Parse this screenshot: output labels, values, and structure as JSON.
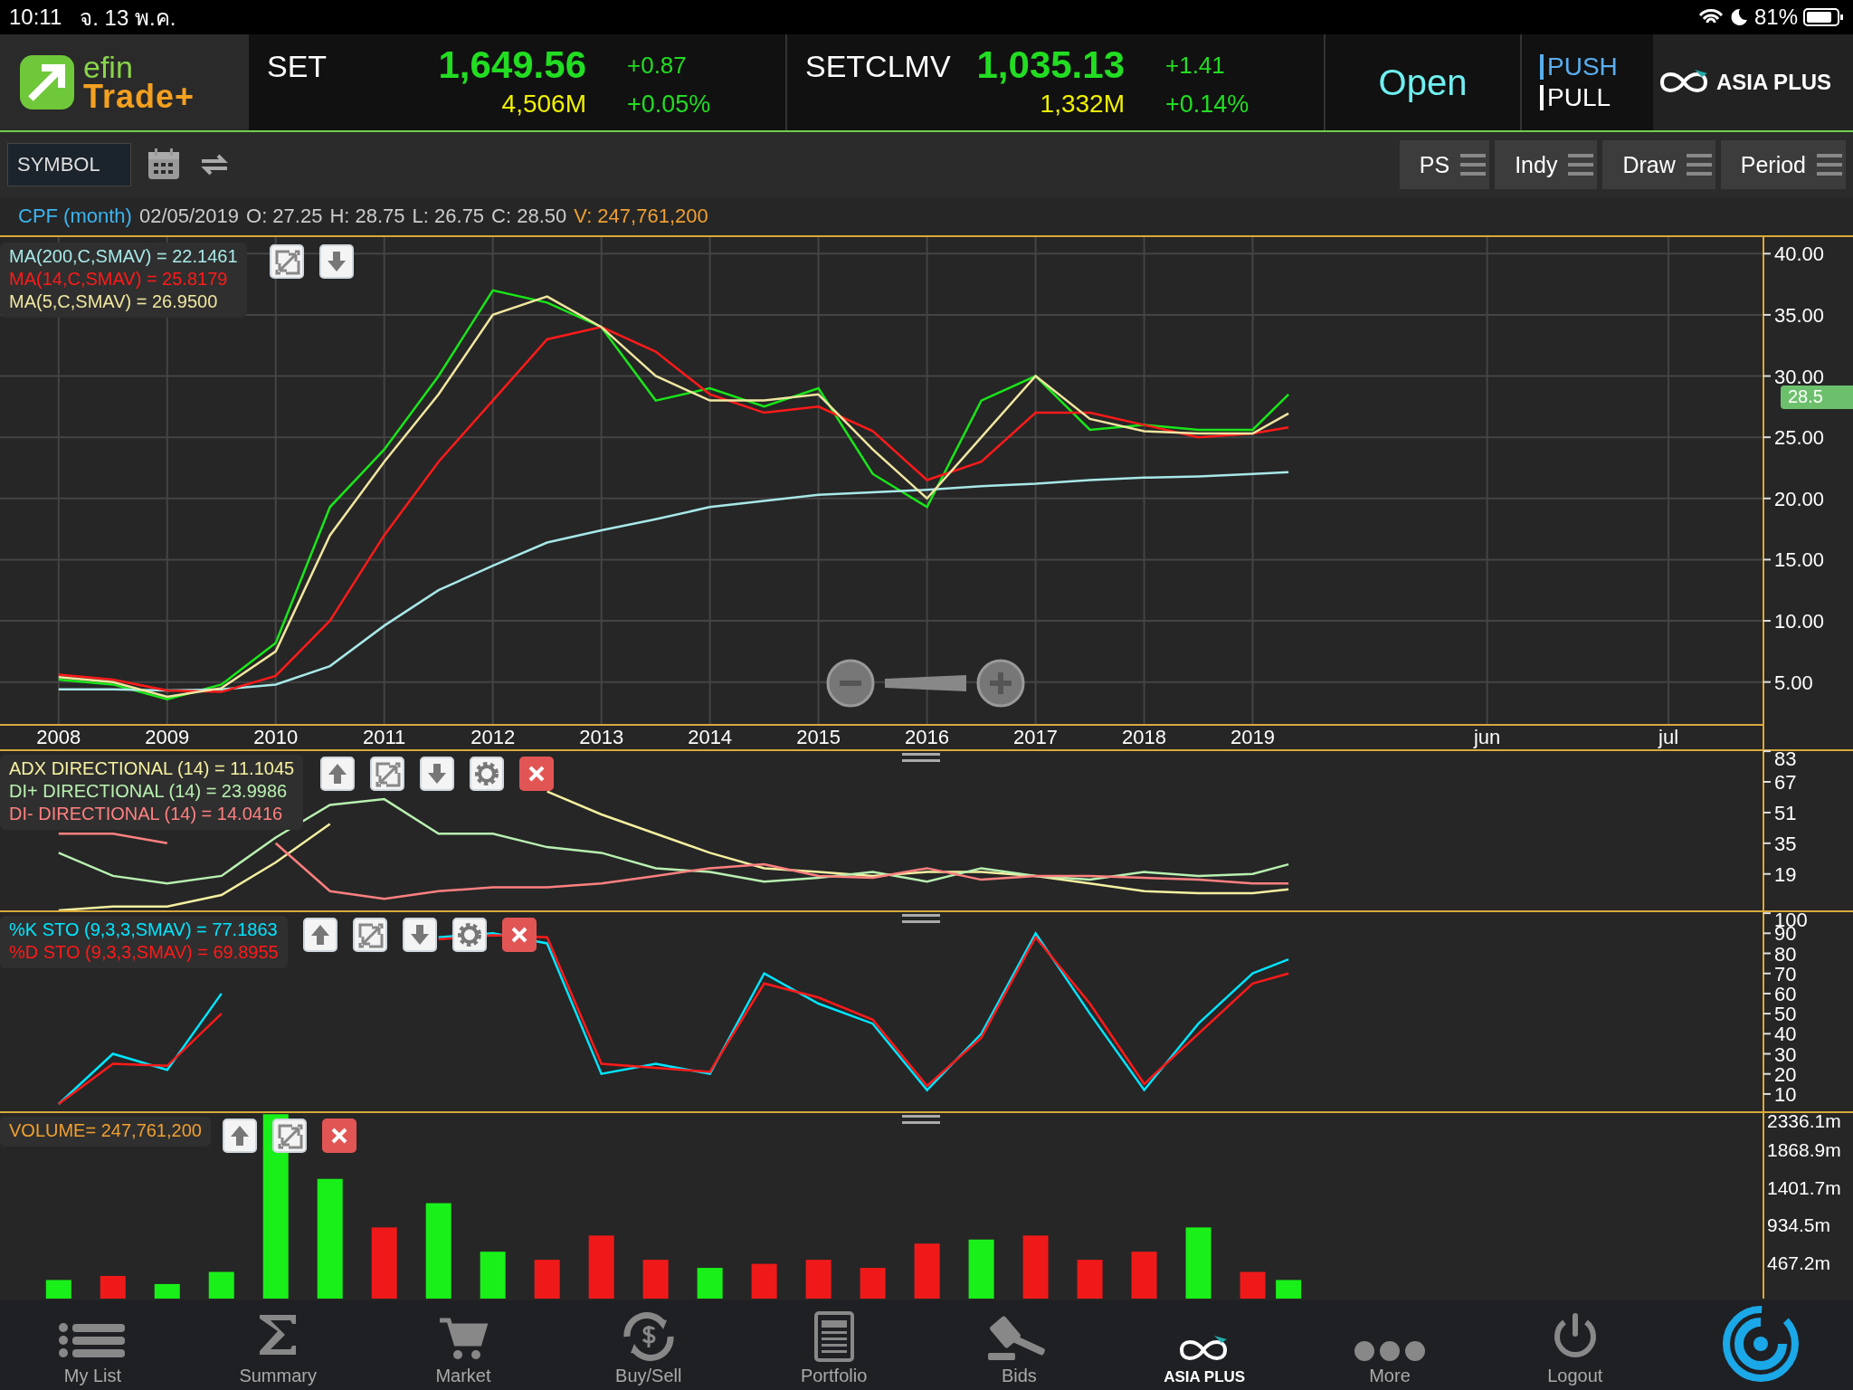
{
  "status_bar": {
    "time": "10:11",
    "date": "จ. 13 พ.ค.",
    "battery": "81%"
  },
  "header": {
    "logo": {
      "line1": "efin",
      "line2": "Trade+"
    },
    "indices": [
      {
        "name": "SET",
        "value": "1,649.56",
        "change": "+0.87",
        "volume": "4,506M",
        "percent": "+0.05%"
      },
      {
        "name": "SETCLMV",
        "value": "1,035.13",
        "change": "+1.41",
        "volume": "1,332M",
        "percent": "+0.14%"
      }
    ],
    "market_status": "Open",
    "modes": [
      {
        "label": "PUSH",
        "selected": true
      },
      {
        "label": "PULL",
        "selected": false
      }
    ],
    "broker_logo": "ASIA PLUS"
  },
  "toolbar": {
    "symbol": {
      "placeholder": "SYMBOL"
    },
    "menus": [
      "PS",
      "Indy",
      "Draw",
      "Period"
    ]
  },
  "info_line": [
    {
      "kind": "symbol",
      "text": "CPF (month)"
    },
    {
      "kind": "plain",
      "text": "02/05/2019"
    },
    {
      "kind": "plain",
      "text": "O:  27.25"
    },
    {
      "kind": "plain",
      "text": "H:  28.75"
    },
    {
      "kind": "plain",
      "text": "L:  26.75"
    },
    {
      "kind": "plain",
      "text": "C:  28.50"
    },
    {
      "kind": "volume",
      "text": "V:  247,761,200"
    }
  ],
  "panels": [
    {
      "kind": "price",
      "legend": [
        {
          "text": "MA(200,C,SMAV) = 22.1461",
          "color": "#a8e8e8"
        },
        {
          "text": "MA(14,C,SMAV) = 25.8179",
          "color": "#ff1a1a"
        },
        {
          "text": "MA(5,C,SMAV) = 26.9500",
          "color": "#f0e6a0"
        }
      ],
      "tools": [
        {
          "kind": "maximize"
        },
        {
          "kind": "down"
        }
      ],
      "last_price_tag": "28.5",
      "chart_data": {
        "type": "line",
        "grid": true,
        "x": [
          2008,
          2008.5,
          2009,
          2009.5,
          2010,
          2010.5,
          2011,
          2011.5,
          2012,
          2012.5,
          2013,
          2013.5,
          2014,
          2014.5,
          2015,
          2015.5,
          2016,
          2016.5,
          2017,
          2017.5,
          2018,
          2018.5,
          2019,
          2019.33
        ],
        "xlim": [
          2007.46,
          2024.53
        ],
        "ylim": [
          1.5,
          41.5
        ],
        "xticks": [
          {
            "value": 2008,
            "label": "2008"
          },
          {
            "value": 2009,
            "label": "2009"
          },
          {
            "value": 2010,
            "label": "2010"
          },
          {
            "value": 2011,
            "label": "2011"
          },
          {
            "value": 2012,
            "label": "2012"
          },
          {
            "value": 2013,
            "label": "2013"
          },
          {
            "value": 2014,
            "label": "2014"
          },
          {
            "value": 2015,
            "label": "2015"
          },
          {
            "value": 2016,
            "label": "2016"
          },
          {
            "value": 2017,
            "label": "2017"
          },
          {
            "value": 2018,
            "label": "2018"
          },
          {
            "value": 2019,
            "label": "2019"
          },
          {
            "value": 2021.16,
            "label": "jun"
          },
          {
            "value": 2022.83,
            "label": "jul"
          }
        ],
        "yticks": [
          {
            "value": 40,
            "label": "40.00"
          },
          {
            "value": 35,
            "label": "35.00"
          },
          {
            "value": 30,
            "label": "30.00"
          },
          {
            "value": 25,
            "label": "25.00"
          },
          {
            "value": 20,
            "label": "20.00"
          },
          {
            "value": 15,
            "label": "15.00"
          },
          {
            "value": 10,
            "label": "10.00"
          },
          {
            "value": 5,
            "label": "5.00"
          }
        ],
        "series": [
          {
            "color": "#19e619",
            "values": [
              5.2,
              4.8,
              3.6,
              4.8,
              8.2,
              19.3,
              24,
              30,
              37,
              36,
              34,
              28,
              29,
              27.5,
              29,
              22,
              19.3,
              28,
              30,
              25.6,
              26,
              25.6,
              25.6,
              28.5
            ]
          },
          {
            "color": "#a8e8e8",
            "values": [
              4.4,
              4.4,
              4.3,
              4.4,
              4.8,
              6.3,
              9.6,
              12.5,
              14.5,
              16.4,
              17.4,
              18.3,
              19.3,
              19.8,
              20.3,
              20.5,
              20.7,
              21,
              21.2,
              21.5,
              21.7,
              21.8,
              22,
              22.15
            ]
          },
          {
            "color": "#ff1a1a",
            "values": [
              5.6,
              5.2,
              4.3,
              4.2,
              5.5,
              10,
              17,
              23,
              28,
              33,
              34,
              32,
              28.5,
              27,
              27.5,
              25.5,
              21.5,
              23,
              27,
              27,
              26,
              25,
              25.3,
              25.8
            ]
          },
          {
            "color": "#f0e6a0",
            "values": [
              5.4,
              5,
              3.8,
              4.5,
              7.5,
              17,
              23,
              28.5,
              35,
              36.5,
              34,
              30,
              28,
              28,
              28.5,
              24,
              20,
              25,
              30,
              26.5,
              25.5,
              25.3,
              25.3,
              26.95
            ]
          }
        ]
      }
    },
    {
      "kind": "adx",
      "legend": [
        {
          "text": "ADX DIRECTIONAL (14) = 11.1045",
          "color": "#f5f0a0"
        },
        {
          "text": "DI+ DIRECTIONAL (14) = 23.9986",
          "color": "#b8f0b0"
        },
        {
          "text": "DI- DIRECTIONAL (14) = 14.0416",
          "color": "#ff8080"
        }
      ],
      "tools": [
        {
          "kind": "up"
        },
        {
          "kind": "maximize"
        },
        {
          "kind": "down"
        },
        {
          "kind": "settings"
        },
        {
          "kind": "close"
        }
      ],
      "chart_data": {
        "type": "line",
        "x": [
          2008,
          2008.5,
          2009,
          2009.5,
          2010,
          2010.5,
          2011,
          2011.5,
          2012,
          2012.5,
          2013,
          2013.5,
          2014,
          2014.5,
          2015,
          2015.5,
          2016,
          2016.5,
          2017,
          2017.5,
          2018,
          2018.5,
          2019,
          2019.33
        ],
        "xlim": [
          2007.46,
          2024.53
        ],
        "ylim": [
          0,
          84
        ],
        "yticks": [
          83,
          67,
          51,
          35,
          19
        ],
        "series": [
          {
            "color": "#f5f0a0",
            "values": [
              0,
              2,
              2,
              8,
              25,
              45,
              null,
              null,
              null,
              62,
              50,
              40,
              30,
              22,
              20,
              18,
              20,
              20,
              18,
              14,
              10,
              9,
              9,
              11
            ]
          },
          {
            "color": "#b8f0b0",
            "values": [
              30,
              18,
              14,
              18,
              38,
              55,
              58,
              40,
              40,
              33,
              30,
              22,
              20,
              15,
              17,
              20,
              15,
              22,
              18,
              16,
              20,
              18,
              19,
              24
            ]
          },
          {
            "color": "#ff8080",
            "values": [
              40,
              40,
              35,
              null,
              35,
              10,
              6,
              10,
              12,
              12,
              14,
              18,
              22,
              24,
              18,
              17,
              22,
              16,
              18,
              18,
              17,
              16,
              14,
              14
            ]
          }
        ]
      }
    },
    {
      "kind": "stochastic",
      "legend": [
        {
          "text": "%K STO (9,3,3,SMAV) = 77.1863",
          "color": "#00e5ff"
        },
        {
          "text": "%D STO (9,3,3,SMAV) = 69.8955",
          "color": "#ff1a1a"
        }
      ],
      "tools": [
        {
          "kind": "up"
        },
        {
          "kind": "maximize"
        },
        {
          "kind": "down"
        },
        {
          "kind": "settings"
        },
        {
          "kind": "close"
        }
      ],
      "chart_data": {
        "type": "line",
        "x": [
          2008,
          2008.5,
          2009,
          2009.5,
          2011.5,
          2012,
          2012.5,
          2013,
          2013.5,
          2014,
          2014.5,
          2015,
          2015.5,
          2016,
          2016.5,
          2017,
          2017.5,
          2018,
          2018.5,
          2019,
          2019.33
        ],
        "xlim": [
          2007.46,
          2024.53
        ],
        "ylim": [
          1.4,
          101.4
        ],
        "yticks": [
          100,
          90,
          80,
          70,
          60,
          50,
          40,
          30,
          20,
          10
        ],
        "series": [
          {
            "color": "#00e5ff",
            "values": [
              5,
              30,
              22,
              60,
              88,
              90,
              85,
              20,
              25,
              20,
              70,
              55,
              45,
              12,
              40,
              90,
              50,
              12,
              45,
              70,
              77
            ]
          },
          {
            "color": "#ff1a1a",
            "values": [
              5,
              25,
              24,
              50,
              87,
              89,
              88,
              25,
              23,
              21,
              65,
              58,
              47,
              14,
              38,
              88,
              55,
              15,
              40,
              65,
              70
            ]
          }
        ]
      }
    },
    {
      "kind": "volume",
      "legend": [
        {
          "text": "VOLUME= 247,761,200",
          "color": "#f0a030"
        }
      ],
      "tools": [
        {
          "kind": "up"
        },
        {
          "kind": "maximize"
        },
        {
          "kind": "close"
        }
      ],
      "chart_data": {
        "type": "bar",
        "x": [
          2008,
          2008.5,
          2009,
          2009.5,
          2010,
          2010.5,
          2011,
          2011.5,
          2012,
          2012.5,
          2013,
          2013.5,
          2014,
          2014.5,
          2015,
          2015.5,
          2016,
          2016.5,
          2017,
          2017.5,
          2018,
          2018.5,
          2019,
          2019.33
        ],
        "xlim": [
          2007.46,
          2024.53
        ],
        "ylim": [
          20,
          2336.1
        ],
        "yticks": [
          {
            "value": 2336.1,
            "label": "2336.1m"
          },
          {
            "value": 1868.9,
            "label": "1868.9m"
          },
          {
            "value": 1401.7,
            "label": "1401.7m"
          },
          {
            "value": 934.5,
            "label": "934.5m"
          },
          {
            "value": 467.2,
            "label": "467.2m"
          }
        ],
        "series": [
          {
            "color": "#19f019",
            "values": [
              250,
              null,
              200,
              350,
              2300,
              1500,
              null,
              1200,
              600,
              null,
              null,
              null,
              400,
              null,
              null,
              null,
              null,
              750,
              null,
              null,
              null,
              900,
              null,
              250
            ]
          },
          {
            "color": "#f01919",
            "values": [
              null,
              300,
              null,
              null,
              null,
              null,
              900,
              null,
              null,
              500,
              800,
              500,
              null,
              450,
              500,
              400,
              700,
              null,
              800,
              500,
              600,
              null,
              350,
              null
            ]
          }
        ]
      }
    }
  ],
  "nav": [
    {
      "kind": "list",
      "label": "My List"
    },
    {
      "kind": "sigma",
      "label": "Summary"
    },
    {
      "kind": "cart",
      "label": "Market"
    },
    {
      "kind": "exchange",
      "label": "Buy/Sell"
    },
    {
      "kind": "document",
      "label": "Portfolio"
    },
    {
      "kind": "gavel",
      "label": "Bids"
    },
    {
      "kind": "brand",
      "label": "ASIA PLUS"
    },
    {
      "kind": "dots",
      "label": "More"
    },
    {
      "kind": "power",
      "label": "Logout"
    },
    {
      "kind": "swirl"
    }
  ]
}
